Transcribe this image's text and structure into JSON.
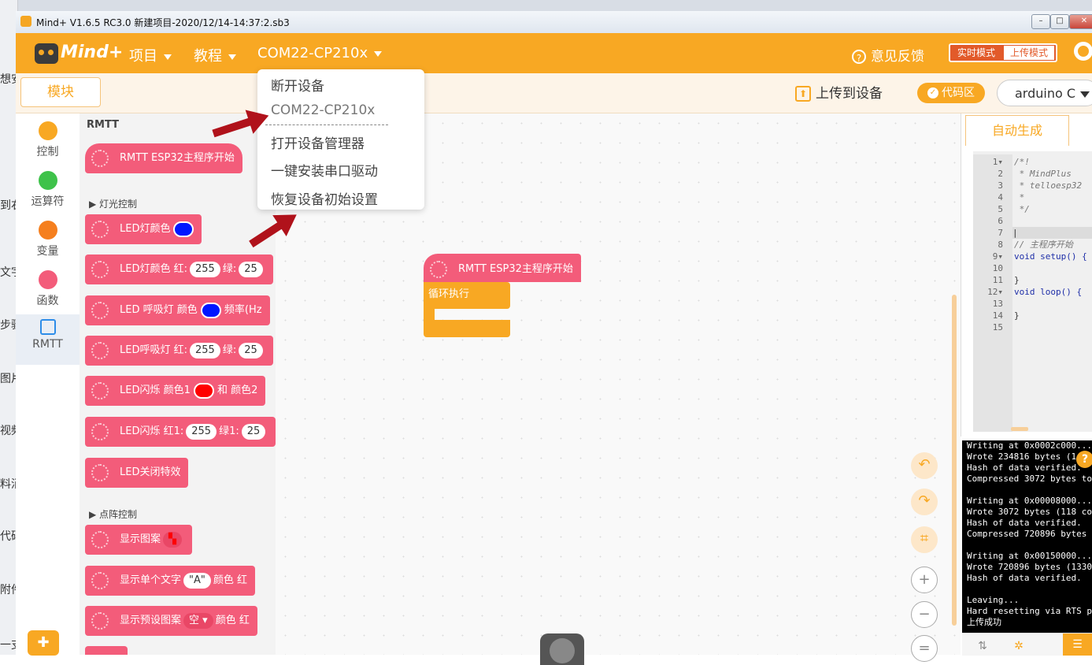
{
  "background_window": {
    "left_strip_texts": [
      "想安",
      "到右",
      "文字",
      "步骤",
      "图片",
      "视频",
      "料消",
      "代码",
      "附件",
      "一支"
    ]
  },
  "titlebar": {
    "title": "Mind+ V1.6.5 RC3.0  新建项目-2020/12/14-14:37:2.sb3",
    "min": "–",
    "max": "□",
    "close": "✕"
  },
  "menubar": {
    "logo_text": "Mind+",
    "project": "项目",
    "tutorial": "教程",
    "device": "COM22-CP210x",
    "feedback": "意见反馈",
    "mode_realtime": "实时模式",
    "mode_upload": "上传模式"
  },
  "toolbar": {
    "blocks_tab": "模块",
    "upload": "上传到设备",
    "code_toggle": "代码区",
    "language": "arduino C"
  },
  "dropdown": {
    "items": [
      "断开设备",
      "COM22-CP210x",
      "打开设备管理器",
      "一键安装串口驱动",
      "恢复设备初始设置"
    ]
  },
  "categories": [
    {
      "label": "控制",
      "color": "#f8a823"
    },
    {
      "label": "运算符",
      "color": "#3ec24a"
    },
    {
      "label": "变量",
      "color": "#f57f1e"
    },
    {
      "label": "函数",
      "color": "#f35c7a"
    },
    {
      "label": "RMTT",
      "color": "#2e8de8"
    }
  ],
  "flyout": {
    "title": "RMTT",
    "section_light": "灯光控制",
    "section_matrix": "点阵控制",
    "blocks": {
      "main": "RMTT ESP32主程序开始",
      "led_color": "LED灯颜色",
      "led_rgb": "LED灯颜色 红:",
      "led_rgb_g": "绿:",
      "led_breathe": "LED 呼吸灯 颜色",
      "led_breathe_freq": "频率(Hz",
      "led_breathe_rgb": "LED呼吸灯 红:",
      "led_breathe_rgb_g": "绿:",
      "led_blink": "LED闪烁 颜色1",
      "led_blink_and": "和 颜色2",
      "led_blink_rgb": "LED闪烁 红1:",
      "led_blink_rgb_g": "绿1:",
      "led_off": "LED关闭特效",
      "show_pattern": "显示图案",
      "show_char": "显示单个文字",
      "show_char_val": "\"A\"",
      "show_char_color": "颜色",
      "show_char_red": "红",
      "show_preset": "显示预设图案",
      "show_preset_val": "空 ▾",
      "show_preset_color": "颜色",
      "show_preset_red": "红",
      "val_255": "255",
      "val_25": "25"
    }
  },
  "workspace": {
    "hat": "RMTT ESP32主程序开始",
    "loop": "循环执行"
  },
  "code_panel": {
    "tab": "自动生成",
    "lines": [
      {
        "n": "1▾",
        "t": "/*!",
        "c": "cm"
      },
      {
        "n": "2",
        "t": " * MindPlus",
        "c": "cm"
      },
      {
        "n": "3",
        "t": " * telloesp32",
        "c": "cm"
      },
      {
        "n": "4",
        "t": " *",
        "c": "cm"
      },
      {
        "n": "5",
        "t": " */",
        "c": "cm"
      },
      {
        "n": "6",
        "t": "",
        "c": ""
      },
      {
        "n": "7",
        "t": "|",
        "c": "cur"
      },
      {
        "n": "8",
        "t": "// 主程序开始",
        "c": "cm"
      },
      {
        "n": "9▾",
        "t": "void setup() {",
        "c": "kw"
      },
      {
        "n": "10",
        "t": "",
        "c": ""
      },
      {
        "n": "11",
        "t": "}",
        "c": ""
      },
      {
        "n": "12▾",
        "t": "void loop() {",
        "c": "kw"
      },
      {
        "n": "13",
        "t": "",
        "c": ""
      },
      {
        "n": "14",
        "t": "}",
        "c": ""
      },
      {
        "n": "15",
        "t": "",
        "c": ""
      }
    ]
  },
  "console": {
    "lines": [
      "Writing at 0x0002c000...",
      "Wrote 234816 bytes (1",
      "Hash of data verified.",
      "Compressed 3072 bytes to",
      "",
      "Writing at 0x00008000...",
      "Wrote 3072 bytes (118 co",
      "Hash of data verified.",
      "Compressed 720896 bytes",
      "",
      "Writing at 0x00150000...",
      "Wrote 720896 bytes (1330",
      "Hash of data verified.",
      "",
      "Leaving...",
      "Hard resetting via RTS p",
      "上传成功"
    ]
  }
}
